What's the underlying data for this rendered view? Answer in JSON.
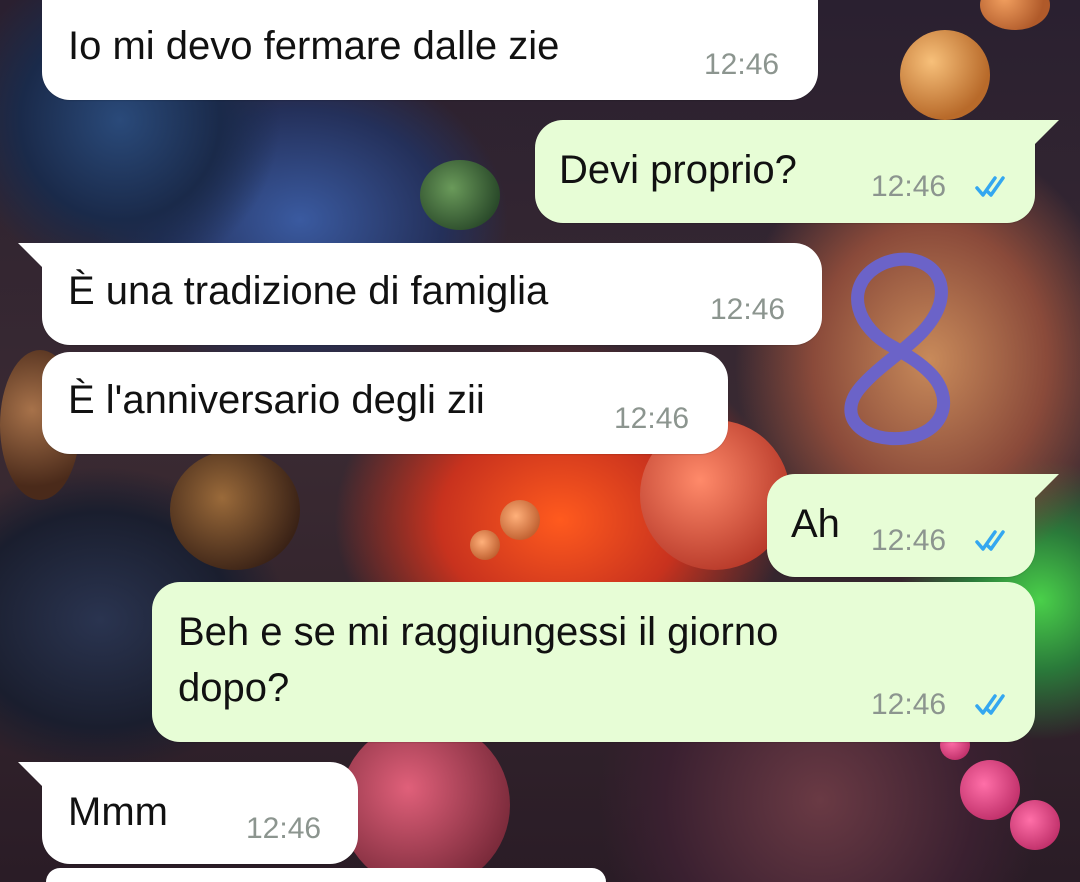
{
  "colors": {
    "incoming_bubble": "#ffffff",
    "outgoing_bubble": "#e7fdd6",
    "text": "#111111",
    "timestamp": "#8c958f",
    "read_ticks": "#34a7f0",
    "drawn_digit": "#6b63c8"
  },
  "messages": [
    {
      "direction": "incoming",
      "text": "Io mi devo fermare dalle zie",
      "time": "12:46"
    },
    {
      "direction": "outgoing",
      "text": "Devi proprio?",
      "time": "12:46",
      "status": "read"
    },
    {
      "direction": "incoming",
      "text": "È una tradizione di famiglia",
      "time": "12:46"
    },
    {
      "direction": "incoming",
      "text": "È l'anniversario degli zii",
      "time": "12:46"
    },
    {
      "direction": "outgoing",
      "text": "Ah",
      "time": "12:46",
      "status": "read"
    },
    {
      "direction": "outgoing",
      "text_line1": "Beh e se mi raggiungessi il giorno",
      "text_line2": "dopo?",
      "time": "12:46",
      "status": "read"
    },
    {
      "direction": "incoming",
      "text": "Mmm",
      "time": "12:46"
    }
  ],
  "annotation": {
    "text": "8",
    "icon": "hand-drawn-eight"
  },
  "icons": {
    "read_status": "double-check-icon"
  }
}
